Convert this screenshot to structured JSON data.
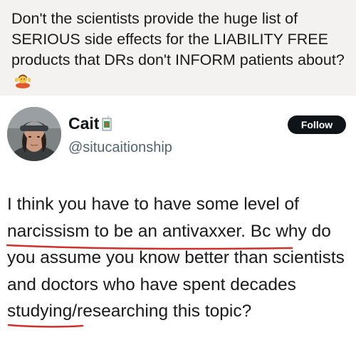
{
  "post": {
    "text": "Don't the scientists provide the huge list of SERIOUS side effects for the LIABILITY FREE products that DRs don't INFORM patients about?",
    "emoji": "person-shrugging-emoji"
  },
  "tweet": {
    "display_name": "Cait",
    "name_emoji": "juice-box-emoji",
    "handle": "@situcaitionship",
    "follow_label": "Follow",
    "text": "I think you have to have some level of narcissism to be an antivaxxer. Bc why do you assume you know better than scientists and doctors who have spent decades studying/researching this topic?"
  },
  "colors": {
    "top_background": "#f3f2f0",
    "follow_button": "#0f1419",
    "handle": "#536471",
    "underline": "#d0302b"
  }
}
